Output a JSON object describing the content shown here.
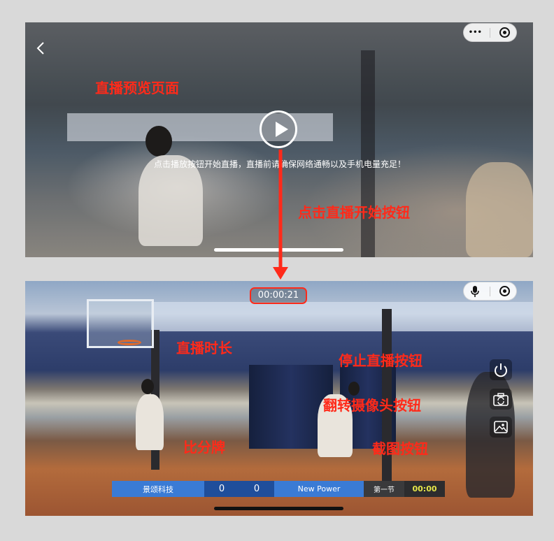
{
  "preview": {
    "label": "直播预览页面",
    "hint": "点击播放按钮开始直播，直播前请确保网络通畅以及手机电量充足！",
    "capsule": {
      "more": "•••"
    }
  },
  "live": {
    "timer": "00:00:21"
  },
  "annotations": {
    "start_button": "点击直播开始按钮",
    "duration": "直播时长",
    "stop_button": "停止直播按钮",
    "flip_camera": "翻转摄像头按钮",
    "screenshot": "截图按钮",
    "scoreboard": "比分牌"
  },
  "scoreboard": {
    "home_team": "景颂科技",
    "home_score": "0",
    "away_score": "0",
    "away_team": "New Power",
    "period": "第一节",
    "clock": "00:00"
  },
  "colors": {
    "annotation_red": "#ff2a1a",
    "scoreboard_blue": "#3a7bd5",
    "scoreboard_dark": "#2c2c2e",
    "clock_yellow": "#e6e64a"
  },
  "icons": [
    "back-icon",
    "more-icon",
    "target-icon",
    "play-icon",
    "mic-icon",
    "power-icon",
    "camera-flip-icon",
    "image-icon",
    "arrow-icon"
  ]
}
